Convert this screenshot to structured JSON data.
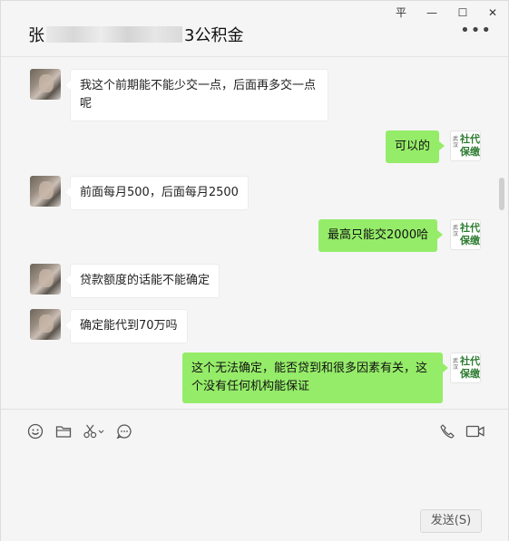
{
  "window": {
    "title_prefix": "张",
    "title_suffix": "3公积金",
    "controls": {
      "pin": "平",
      "minimize": "—",
      "maximize": "☐",
      "close": "✕"
    },
    "more": "•••"
  },
  "messages": [
    {
      "side": "left",
      "text": "我这个前期能不能少交一点，后面再多交一点呢"
    },
    {
      "side": "right",
      "text": "可以的"
    },
    {
      "side": "left",
      "text": "前面每月500，后面每月2500"
    },
    {
      "side": "right",
      "text": "最高只能交2000哈"
    },
    {
      "side": "left",
      "text": "贷款额度的话能不能确定"
    },
    {
      "side": "left",
      "text": "确定能代到70万吗"
    },
    {
      "side": "right",
      "text": "这个无法确定，能否贷到和很多因素有关，这个没有任何机构能保证"
    }
  ],
  "self_avatar": {
    "line1": "武汉",
    "line2": "社代",
    "line3": "保缴",
    "brand_color": "#2e7d32"
  },
  "colors": {
    "self_bubble": "#95ec69",
    "other_bubble": "#ffffff",
    "background": "#f5f5f5"
  },
  "toolbar": {
    "icons": [
      "emoji-icon",
      "folder-icon",
      "scissors-icon",
      "chat-history-icon",
      "phone-icon",
      "video-icon"
    ]
  },
  "send_label": "发送(S)"
}
